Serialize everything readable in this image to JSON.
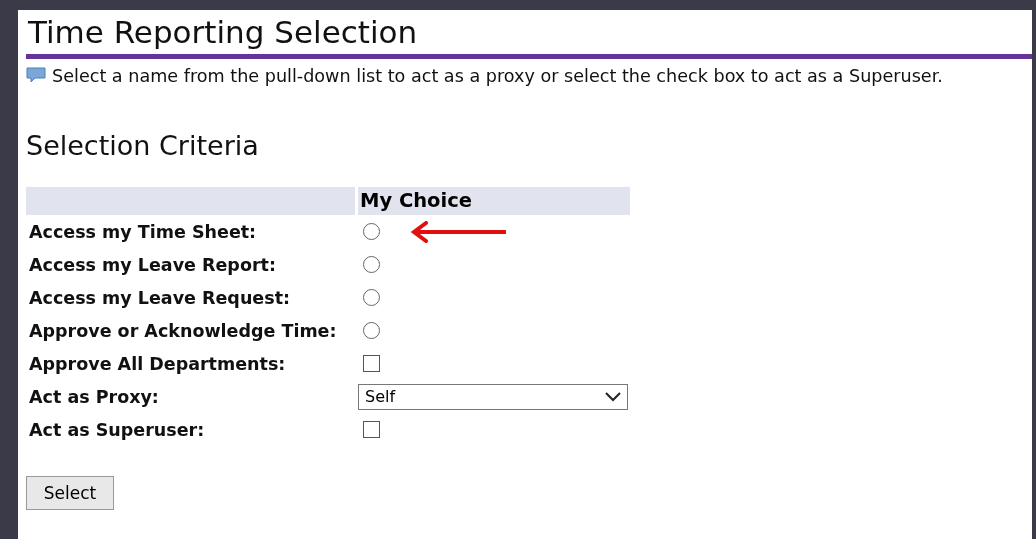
{
  "title": "Time Reporting Selection",
  "instruction": "Select a name from the pull-down list to act as a proxy or select the check box to act as a Superuser.",
  "section_title": "Selection Criteria",
  "table": {
    "columns": [
      "My Choice"
    ],
    "rows": [
      {
        "label": "Access my Time Sheet:",
        "kind": "radio",
        "checked": false,
        "arrow": true
      },
      {
        "label": "Access my Leave Report:",
        "kind": "radio",
        "checked": false,
        "arrow": false
      },
      {
        "label": "Access my Leave Request:",
        "kind": "radio",
        "checked": false,
        "arrow": false
      },
      {
        "label": "Approve or Acknowledge Time:",
        "kind": "radio",
        "checked": false,
        "arrow": false
      },
      {
        "label": "Approve All Departments:",
        "kind": "checkbox",
        "checked": false,
        "arrow": false
      },
      {
        "label": "Act as Proxy:",
        "kind": "select",
        "value": "Self",
        "arrow": false
      },
      {
        "label": "Act as Superuser:",
        "kind": "checkbox",
        "checked": false,
        "arrow": false
      }
    ]
  },
  "buttons": [
    "Select"
  ]
}
